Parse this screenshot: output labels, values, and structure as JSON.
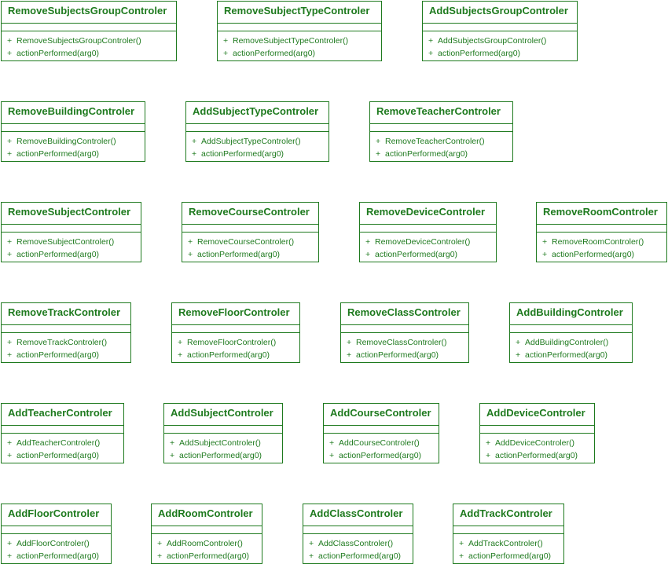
{
  "classes": [
    {
      "name": "RemoveSubjectsGroupControler",
      "operations": [
        "RemoveSubjectsGroupControler()",
        "actionPerformed(arg0)"
      ]
    },
    {
      "name": "RemoveSubjectTypeControler",
      "operations": [
        "RemoveSubjectTypeControler()",
        "actionPerformed(arg0)"
      ]
    },
    {
      "name": "AddSubjectsGroupControler",
      "operations": [
        "AddSubjectsGroupControler()",
        "actionPerformed(arg0)"
      ]
    },
    {
      "name": "RemoveBuildingControler",
      "operations": [
        "RemoveBuildingControler()",
        "actionPerformed(arg0)"
      ]
    },
    {
      "name": "AddSubjectTypeControler",
      "operations": [
        "AddSubjectTypeControler()",
        "actionPerformed(arg0)"
      ]
    },
    {
      "name": "RemoveTeacherControler",
      "operations": [
        "RemoveTeacherControler()",
        "actionPerformed(arg0)"
      ]
    },
    {
      "name": "RemoveSubjectControler",
      "operations": [
        "RemoveSubjectControler()",
        "actionPerformed(arg0)"
      ]
    },
    {
      "name": "RemoveCourseControler",
      "operations": [
        "RemoveCourseControler()",
        "actionPerformed(arg0)"
      ]
    },
    {
      "name": "RemoveDeviceControler",
      "operations": [
        "RemoveDeviceControler()",
        "actionPerformed(arg0)"
      ]
    },
    {
      "name": "RemoveRoomControler",
      "operations": [
        "RemoveRoomControler()",
        "actionPerformed(arg0)"
      ]
    },
    {
      "name": "RemoveTrackControler",
      "operations": [
        "RemoveTrackControler()",
        "actionPerformed(arg0)"
      ]
    },
    {
      "name": "RemoveFloorControler",
      "operations": [
        "RemoveFloorControler()",
        "actionPerformed(arg0)"
      ]
    },
    {
      "name": "RemoveClassControler",
      "operations": [
        "RemoveClassControler()",
        "actionPerformed(arg0)"
      ]
    },
    {
      "name": "AddBuildingControler",
      "operations": [
        "AddBuildingControler()",
        "actionPerformed(arg0)"
      ]
    },
    {
      "name": "AddTeacherControler",
      "operations": [
        "AddTeacherControler()",
        "actionPerformed(arg0)"
      ]
    },
    {
      "name": "AddSubjectControler",
      "operations": [
        "AddSubjectControler()",
        "actionPerformed(arg0)"
      ]
    },
    {
      "name": "AddCourseControler",
      "operations": [
        "AddCourseControler()",
        "actionPerformed(arg0)"
      ]
    },
    {
      "name": "AddDeviceControler",
      "operations": [
        "AddDeviceControler()",
        "actionPerformed(arg0)"
      ]
    },
    {
      "name": "AddFloorControler",
      "operations": [
        "AddFloorControler()",
        "actionPerformed(arg0)"
      ]
    },
    {
      "name": "AddRoomControler",
      "operations": [
        "AddRoomControler()",
        "actionPerformed(arg0)"
      ]
    },
    {
      "name": "AddClassControler",
      "operations": [
        "AddClassControler()",
        "actionPerformed(arg0)"
      ]
    },
    {
      "name": "AddTrackControler",
      "operations": [
        "AddTrackControler()",
        "actionPerformed(arg0)"
      ]
    }
  ],
  "visibility_symbol": "+",
  "colors": {
    "line": "#1e7a1e",
    "background": "#ffffff"
  }
}
